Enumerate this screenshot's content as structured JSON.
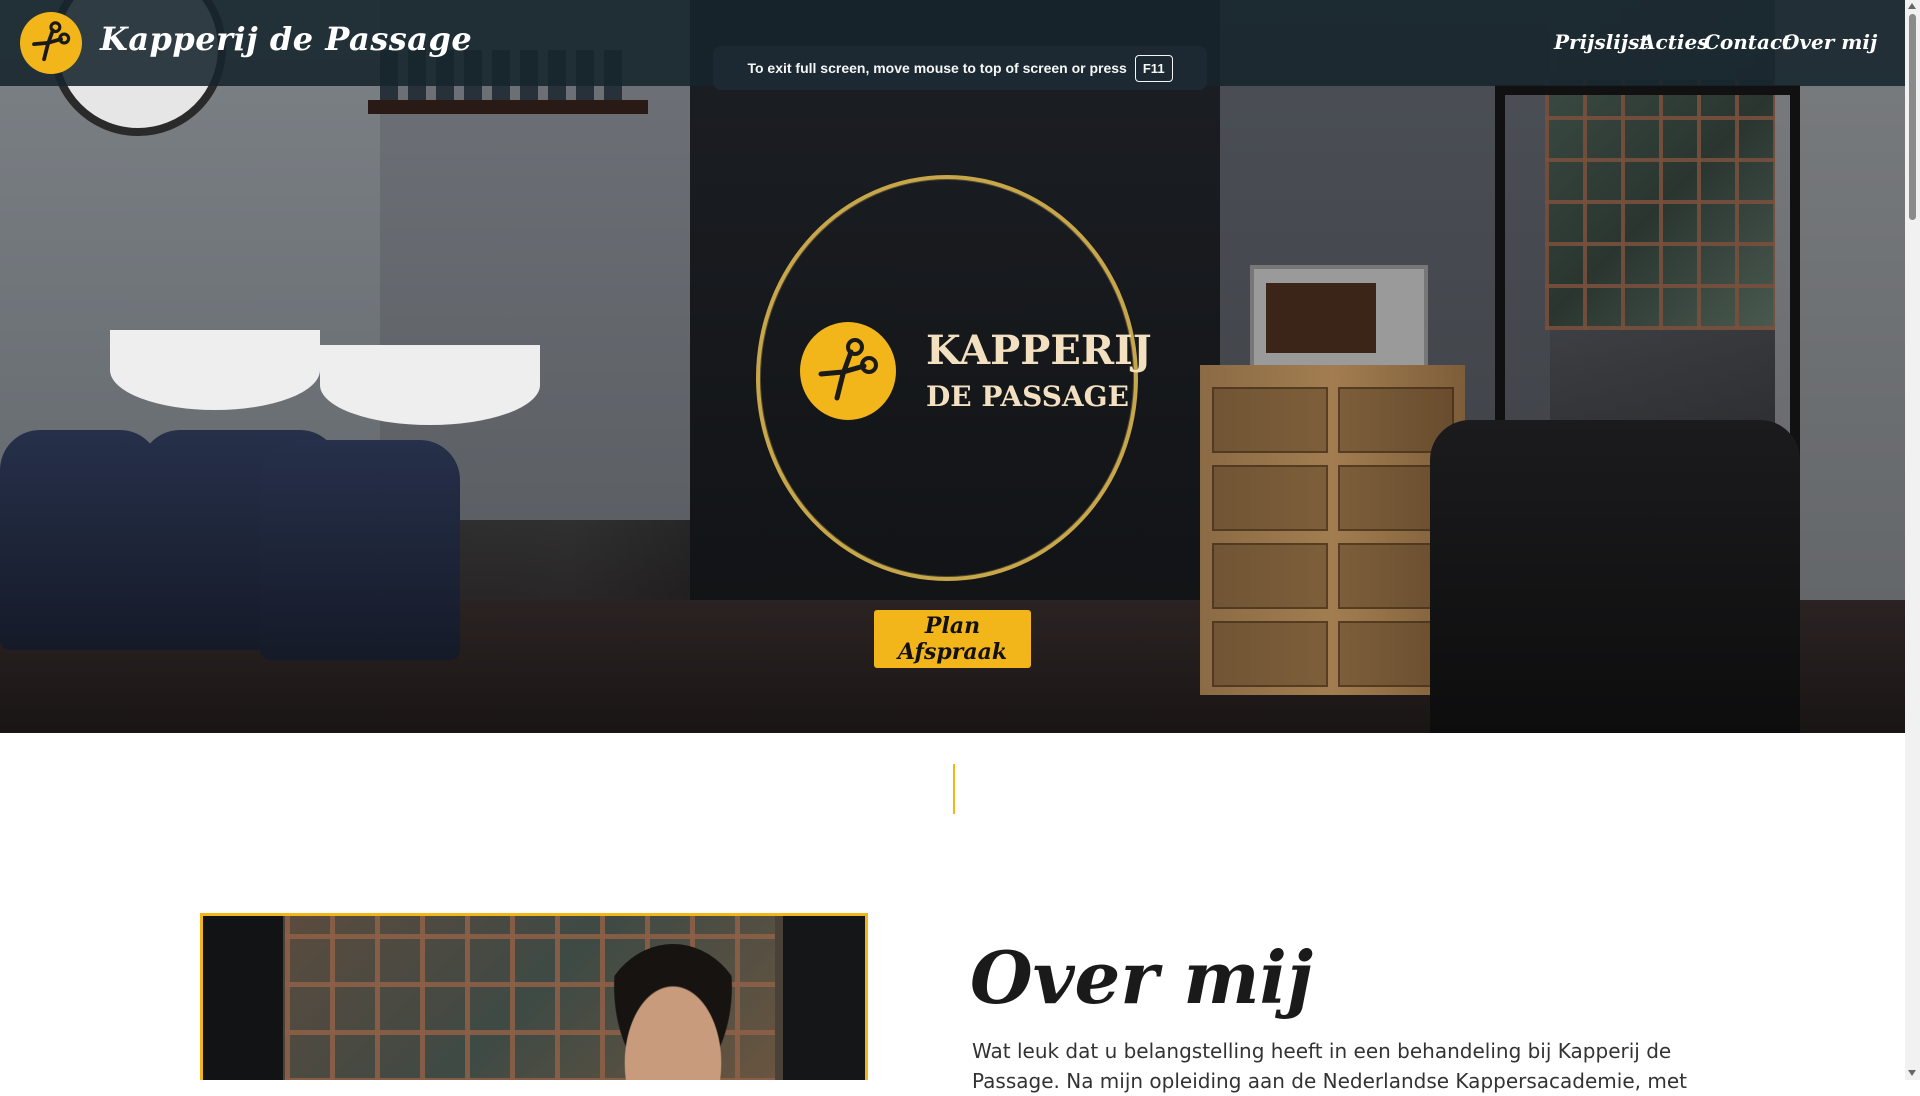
{
  "header": {
    "brand": "Kapperij de Passage",
    "nav": [
      "Prijslijst",
      "Acties",
      "Contact",
      "Over mij"
    ]
  },
  "fullscreen_toast": {
    "message": "To exit full screen, move mouse to top of screen or press",
    "key": "F11"
  },
  "hero": {
    "logo_title": "KAPPERIJ",
    "logo_subtitle": "DE PASSAGE",
    "cta": "Plan Afspraak"
  },
  "about": {
    "title": "Over mij",
    "text": "Wat leuk dat u belangstelling heeft in een behandeling bij Kapperij de Passage. Na mijn opleiding aan de Nederlandse Kappersacademie, met"
  },
  "colors": {
    "accent": "#f2b51a",
    "header_bg": "#16242c",
    "ring": "#c8a64a"
  },
  "icons": {
    "logo": "scissors-icon"
  }
}
